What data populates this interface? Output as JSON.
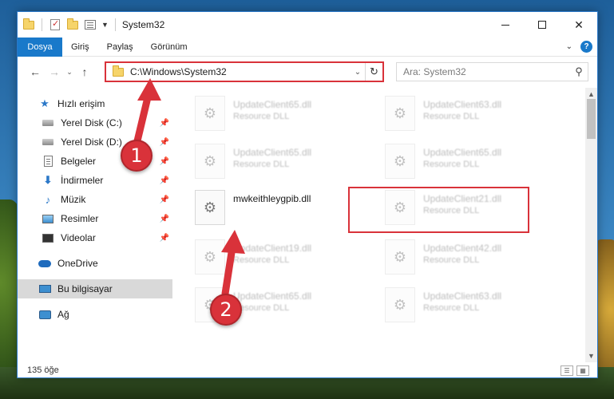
{
  "window": {
    "title": "System32"
  },
  "ribbon": {
    "tabs": [
      "Dosya",
      "Giriş",
      "Paylaş",
      "Görünüm"
    ]
  },
  "address": {
    "path": "C:\\Windows\\System32"
  },
  "search": {
    "placeholder": "Ara: System32"
  },
  "sidebar": {
    "quick_access": "Hızlı erişim",
    "items": [
      "Yerel Disk (C:)",
      "Yerel Disk (D:)",
      "Belgeler",
      "İndirmeler",
      "Müzik",
      "Resimler",
      "Videolar"
    ],
    "onedrive": "OneDrive",
    "this_pc": "Bu bilgisayar",
    "network": "Ağ"
  },
  "files": [
    {
      "name": "UpdateClient65.dll",
      "desc": "Resource DLL"
    },
    {
      "name": "UpdateClient63.dll",
      "desc": "Resource DLL"
    },
    {
      "name": "UpdateClient65.dll",
      "desc": "Resource DLL"
    },
    {
      "name": "UpdateClient65.dll",
      "desc": "Resource DLL"
    },
    {
      "name": "mwkeithleygpib.dll",
      "desc": ""
    },
    {
      "name": "UpdateClient21.dll",
      "desc": "Resource DLL"
    },
    {
      "name": "UpdateClient19.dll",
      "desc": "Resource DLL"
    },
    {
      "name": "UpdateClient42.dll",
      "desc": "Resource DLL"
    },
    {
      "name": "UpdateClient65.dll",
      "desc": "Resource DLL"
    },
    {
      "name": "UpdateClient63.dll",
      "desc": "Resource DLL"
    }
  ],
  "status": {
    "count": "135 öğe"
  },
  "annotations": {
    "step1": "1",
    "step2": "2"
  },
  "colors": {
    "accent": "#1979ca",
    "highlight": "#d9323a"
  }
}
